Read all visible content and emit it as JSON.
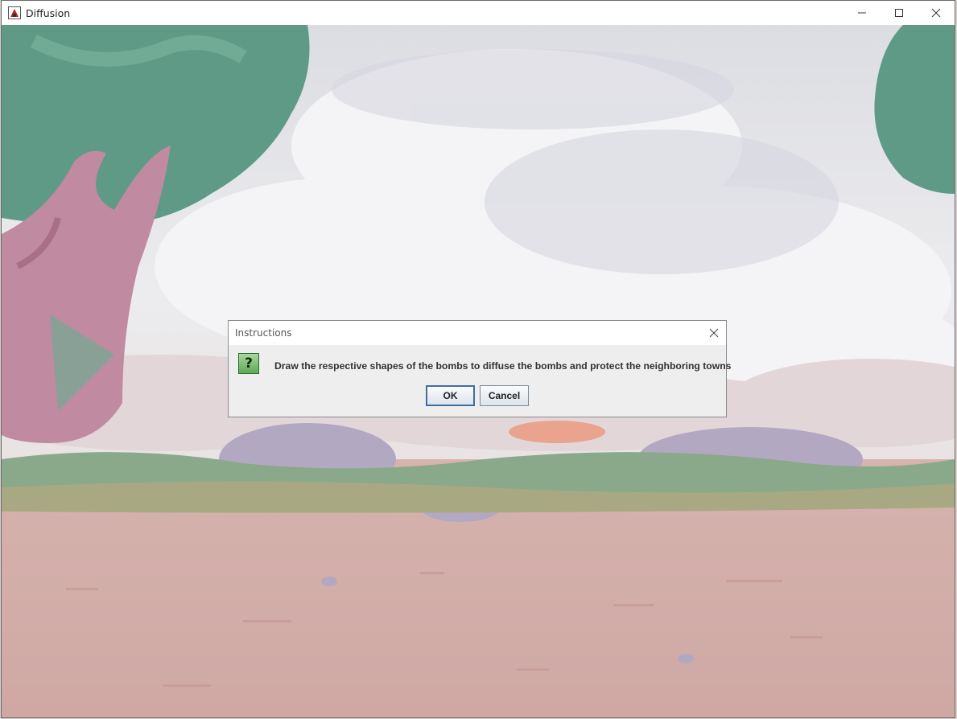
{
  "window": {
    "title": "Diffusion",
    "icon": "app-icon",
    "controls": [
      "minimize-icon",
      "maximize-icon",
      "close-icon"
    ]
  },
  "dialog": {
    "title": "Instructions",
    "icon": "question-icon",
    "icon_glyph": "?",
    "message": "Draw the respective shapes of the bombs to diffuse the bombs and protect the neighboring towns",
    "ok_label": "OK",
    "cancel_label": "Cancel"
  },
  "colors": {
    "sky": "#e8e8ea",
    "tree_foliage": "#5f9a86",
    "tree_trunk": "#c08aa0",
    "ground": "#d2aca8",
    "grass": "#8aa88a",
    "rock": "#b3a8c2"
  }
}
